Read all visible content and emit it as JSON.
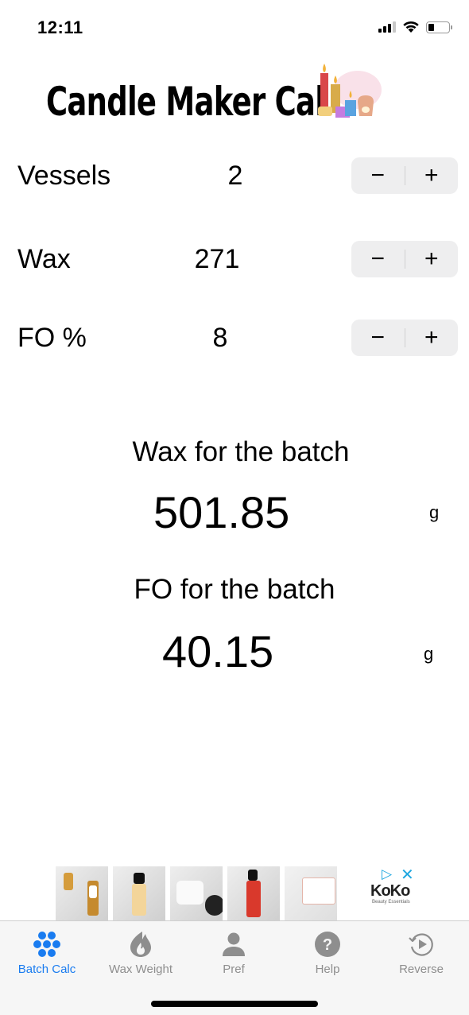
{
  "status_bar": {
    "time": "12:11",
    "icons": [
      "cellular-signal-icon",
      "wifi-icon",
      "battery-icon"
    ]
  },
  "header": {
    "title": "Candle Maker Cal",
    "logo_icon": "candles-illustration-icon"
  },
  "inputs": [
    {
      "label": "Vessels",
      "value": "2",
      "decrement": "−",
      "increment": "+"
    },
    {
      "label": "Wax",
      "value": "271",
      "decrement": "−",
      "increment": "+"
    },
    {
      "label": "FO %",
      "value": "8",
      "decrement": "−",
      "increment": "+"
    }
  ],
  "results": [
    {
      "label": "Wax for the batch",
      "value": "501.85",
      "unit": "g"
    },
    {
      "label": "FO for the batch",
      "value": "40.15",
      "unit": "g"
    }
  ],
  "ad": {
    "brand": "KoKo",
    "tagline": "Beauty Essentials",
    "thumbnails": 5,
    "adchoices_icon": "adchoices-icon",
    "close_icon": "close-icon"
  },
  "tab_bar": {
    "accent_color": "#1a7cf0",
    "inactive_color": "#8e8e8e",
    "tabs": [
      {
        "label": "Batch Calc",
        "icon": "dots-grid-icon",
        "active": true
      },
      {
        "label": "Wax Weight",
        "icon": "flame-icon",
        "active": false
      },
      {
        "label": "Pref",
        "icon": "person-icon",
        "active": false
      },
      {
        "label": "Help",
        "icon": "question-circle-icon",
        "active": false
      },
      {
        "label": "Reverse",
        "icon": "replay-icon",
        "active": false
      }
    ]
  }
}
